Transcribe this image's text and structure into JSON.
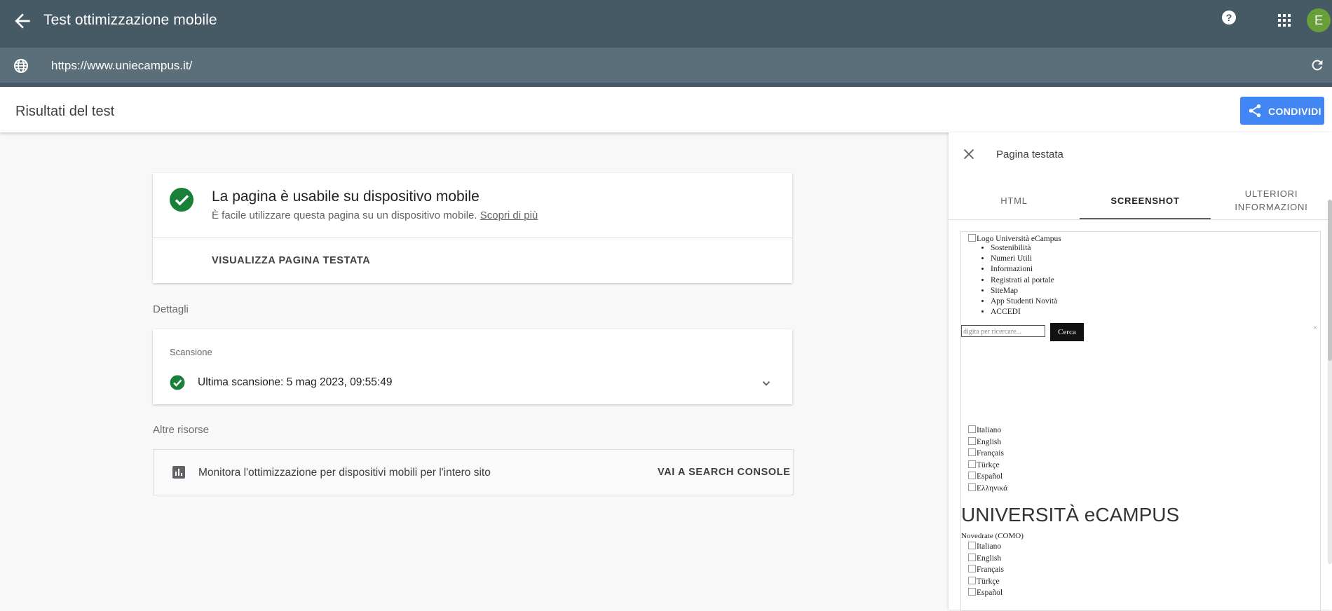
{
  "app": {
    "title": "Test ottimizzazione mobile",
    "avatar_letter": "E",
    "url": "https://www.uniecampus.it/"
  },
  "results": {
    "title": "Risultati del test",
    "share_label": "CONDIVIDI"
  },
  "summary": {
    "heading": "La pagina è usabile su dispositivo mobile",
    "subtext": "È facile utilizzare questa pagina su un dispositivo mobile.",
    "learn_more": "Scopri di più",
    "view_button": "VISUALIZZA PAGINA TESTATA"
  },
  "details": {
    "section_label": "Dettagli",
    "scan_label": "Scansione",
    "last_scan": "Ultima scansione: 5 mag 2023, 09:55:49"
  },
  "resources": {
    "section_label": "Altre risorse",
    "text": "Monitora l'ottimizzazione per dispositivi mobili per l'intero sito",
    "link": "VAI A SEARCH CONSOLE"
  },
  "panel": {
    "title": "Pagina testata",
    "tabs": [
      {
        "label": "HTML"
      },
      {
        "label": "SCREENSHOT"
      },
      {
        "label_line1": "ULTERIORI",
        "label_line2": "INFORMAZIONI"
      }
    ],
    "screenshot": {
      "logo_alt": "Logo Università eCampus",
      "menu": [
        "Sostenibilità",
        "Numeri Utili",
        "Informazioni",
        "Registrati al portale",
        "SiteMap",
        "App Studenti Novità",
        "ACCEDI"
      ],
      "search_placeholder": "digita per ricercare...",
      "search_button": "Cerca",
      "close_mark": "×",
      "languages_1": [
        "Italiano",
        "English",
        "Français",
        "Türkçe",
        "Español",
        "Ελληνικά"
      ],
      "big_title": "UNIVERSITÀ eCAMPUS",
      "town": "Novedrate (COMO)",
      "languages_2": [
        "Italiano",
        "English",
        "Français",
        "Türkçe",
        "Español"
      ]
    }
  },
  "colors": {
    "header_bg": "#465a66",
    "url_bg": "#5b6f7a",
    "accent": "#4285f4",
    "success": "#188038",
    "avatar": "#689f38"
  }
}
